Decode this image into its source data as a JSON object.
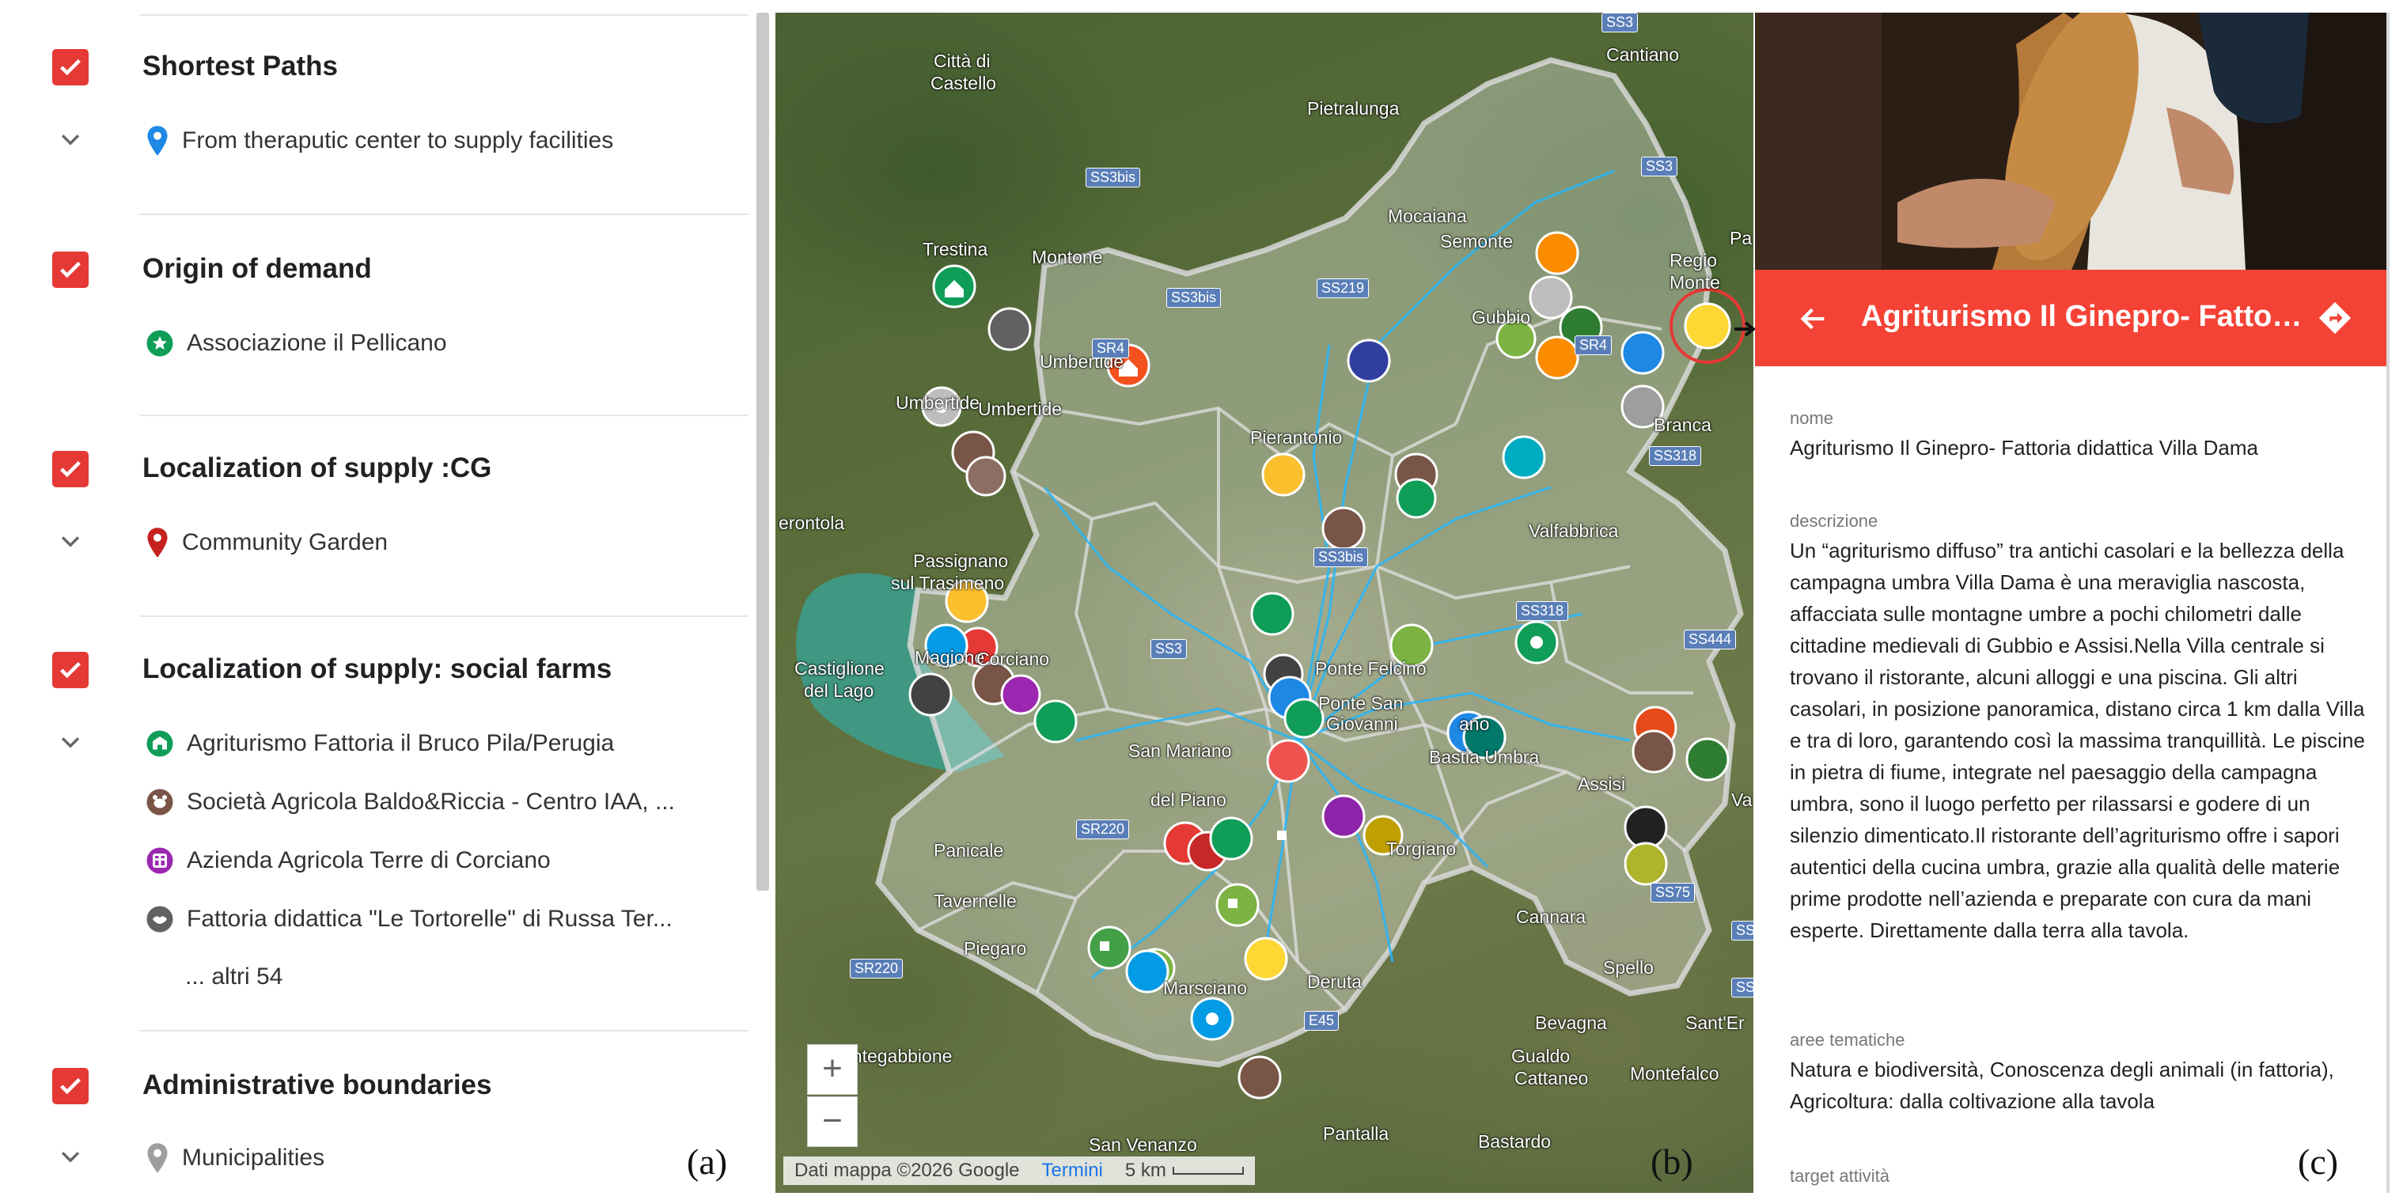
{
  "layers": [
    {
      "title": "Shortest Paths",
      "has_chevron": true,
      "items": [
        {
          "label": "From theraputic center to supply facilities",
          "icon": "pin-icon",
          "color": "#1e88e5"
        }
      ]
    },
    {
      "title": "Origin of demand",
      "has_chevron": false,
      "items": [
        {
          "label": "Associazione il Pellicano",
          "icon": "circle-star-icon",
          "color": "#0f9d58"
        }
      ]
    },
    {
      "title": "Localization of supply :CG",
      "has_chevron": true,
      "items": [
        {
          "label": "Community Garden",
          "icon": "pin-icon",
          "color": "#c5221f"
        }
      ]
    },
    {
      "title": "Localization of supply: social farms",
      "has_chevron": true,
      "items": [
        {
          "label": "Agriturismo Fattoria il Bruco Pila/Perugia",
          "icon": "farm-icon",
          "color": "#0f9d58"
        },
        {
          "label": "Società Agricola Baldo&Riccia - Centro IAA, ...",
          "icon": "animal-icon",
          "color": "#795548"
        },
        {
          "label": "Azienda Agricola Terre di Corciano",
          "icon": "grape-icon",
          "color": "#9c27b0"
        },
        {
          "label": "Fattoria didattica \"Le Tortorelle\" di Russa Ter...",
          "icon": "bird-icon",
          "color": "#616161"
        }
      ],
      "more": "... altri 54"
    },
    {
      "title": "Administrative boundaries",
      "has_chevron": true,
      "items": [
        {
          "label": "Municipalities",
          "icon": "pin-icon",
          "color": "#9e9e9e"
        }
      ]
    }
  ],
  "figure_labels": {
    "a": "(a)",
    "b": "(b)",
    "c": "(c)"
  },
  "map": {
    "places": [
      "Città di",
      "Castello",
      "Pietralunga",
      "Cantiano",
      "Mocaiana",
      "Semonte",
      "Trestina",
      "Montone",
      "Gubbio",
      "Umbertide",
      "Umbertide",
      "Umbertide",
      "Pierantonio",
      "Branca",
      "Regio",
      "Monte",
      "Pa",
      "erontola",
      "Passignano",
      "sul Trasimeno",
      "Castiglione",
      "del Lago",
      "Magione",
      "Corciano",
      "Ponte Felcino",
      "Valfabbrica",
      "Ponte San",
      "Giovanni",
      "Bastia Umbra",
      "Assisi",
      "San Mariano",
      "del Piano",
      "Panicale",
      "Tavernelle",
      "Piegaro",
      "Torgiano",
      "Marsciano",
      "Deruta",
      "Cannara",
      "Spello",
      "Bevagna",
      "Sant'Er",
      "ontegabbione",
      "Gualdo",
      "Cattaneo",
      "Montefalco",
      "San Venanzo",
      "Pantalla",
      "Bastardo",
      "ano",
      "Va"
    ],
    "roads": [
      "SS3bis",
      "SS3bis",
      "SS219",
      "SS3",
      "SR4",
      "SR4",
      "SS318",
      "SS3bis",
      "SS318",
      "SS444",
      "SS75",
      "SS3",
      "SR220",
      "SR220",
      "SS3",
      "SS3",
      "SS3",
      "E45"
    ],
    "zoom_in": "+",
    "zoom_out": "−",
    "attribution": "Dati mappa ©2026 Google",
    "terms": "Termini",
    "scale": "5 km"
  },
  "info": {
    "title": "Agriturismo Il Ginepro- Fattoria didattica Villa Dama",
    "fields": [
      {
        "label": "nome",
        "value": "Agriturismo Il Ginepro- Fattoria didattica Villa Dama"
      },
      {
        "label": "descrizione",
        "value": "Un “agriturismo diffuso” tra antichi casolari e la bellezza della campagna umbra Villa Dama è una meraviglia nascosta, affacciata sulle montagne umbre a pochi chilometri dalle cittadine medievali di Gubbio e Assisi.Nella Villa centrale si trovano il ristorante, alcuni alloggi e una piscina. Gli altri casolari, in posizione panoramica, distano circa 1 km dalla Villa e tra di loro, garantendo così la massima tranquillità. Le piscine in pietra di fiume, integrate nel paesaggio della campagna umbra, sono il luogo perfetto per rilassarsi e godere di un silenzio dimenticato.Il ristorante dell’agriturismo offre i sapori autentici della cucina umbra, grazie alla qualità delle materie prime prodotte nell’azienda e preparate con cura da mani esperte. Direttamente dalla terra alla tavola."
      },
      {
        "label": "aree tematiche",
        "value": "Natura e biodiversità, Conoscenza degli animali (in fattoria), Agricoltura: dalla coltivazione alla tavola"
      },
      {
        "label": "target attività",
        "value": ""
      }
    ]
  },
  "colors": {
    "accent": "#f44336",
    "checkbox": "#e53935"
  }
}
